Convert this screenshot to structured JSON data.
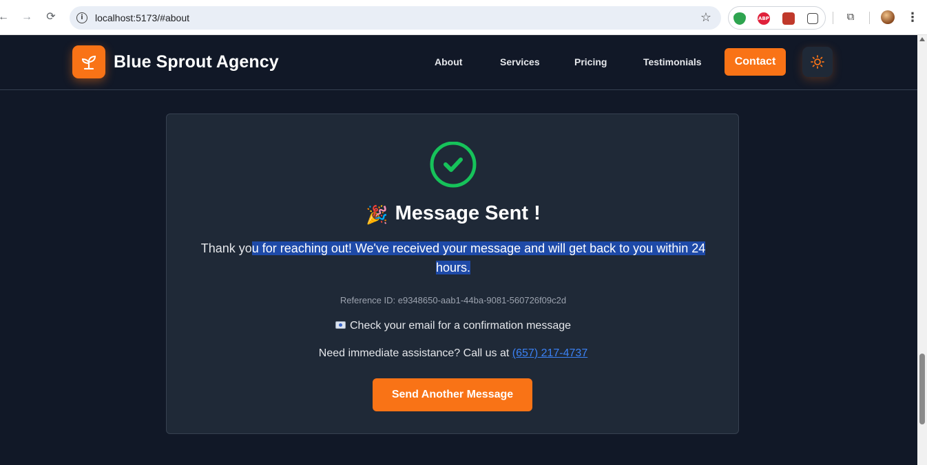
{
  "browser": {
    "url": "localhost:5173/#about",
    "back_icon": "arrow-left-icon",
    "forward_icon": "arrow-right-icon",
    "reload_icon": "reload-icon",
    "extensions": [
      "shield-extension-icon",
      "adblock-extension-icon",
      "extension-red-icon",
      "puzzle-extension-icon"
    ],
    "adblock_label": "ABP"
  },
  "header": {
    "brand": "Blue Sprout Agency",
    "nav": [
      "About",
      "Services",
      "Pricing",
      "Testimonials"
    ],
    "contact_label": "Contact",
    "accent_color": "#f97316"
  },
  "success": {
    "title": "Message Sent !",
    "emoji": "🎉",
    "thanks_pre": "Thank yo",
    "thanks_selected": "u for reaching out! We've received your message and will get back to you within 24 hours.",
    "reference": "Reference ID: e9348650-aab1-44ba-9081-560726f09c2d",
    "email_note": "Check your email for a confirmation message",
    "assist_text": "Need immediate assistance? Call us at ",
    "phone": "(657) 217-4737",
    "button_label": "Send Another Message",
    "success_color": "#16c25a"
  }
}
